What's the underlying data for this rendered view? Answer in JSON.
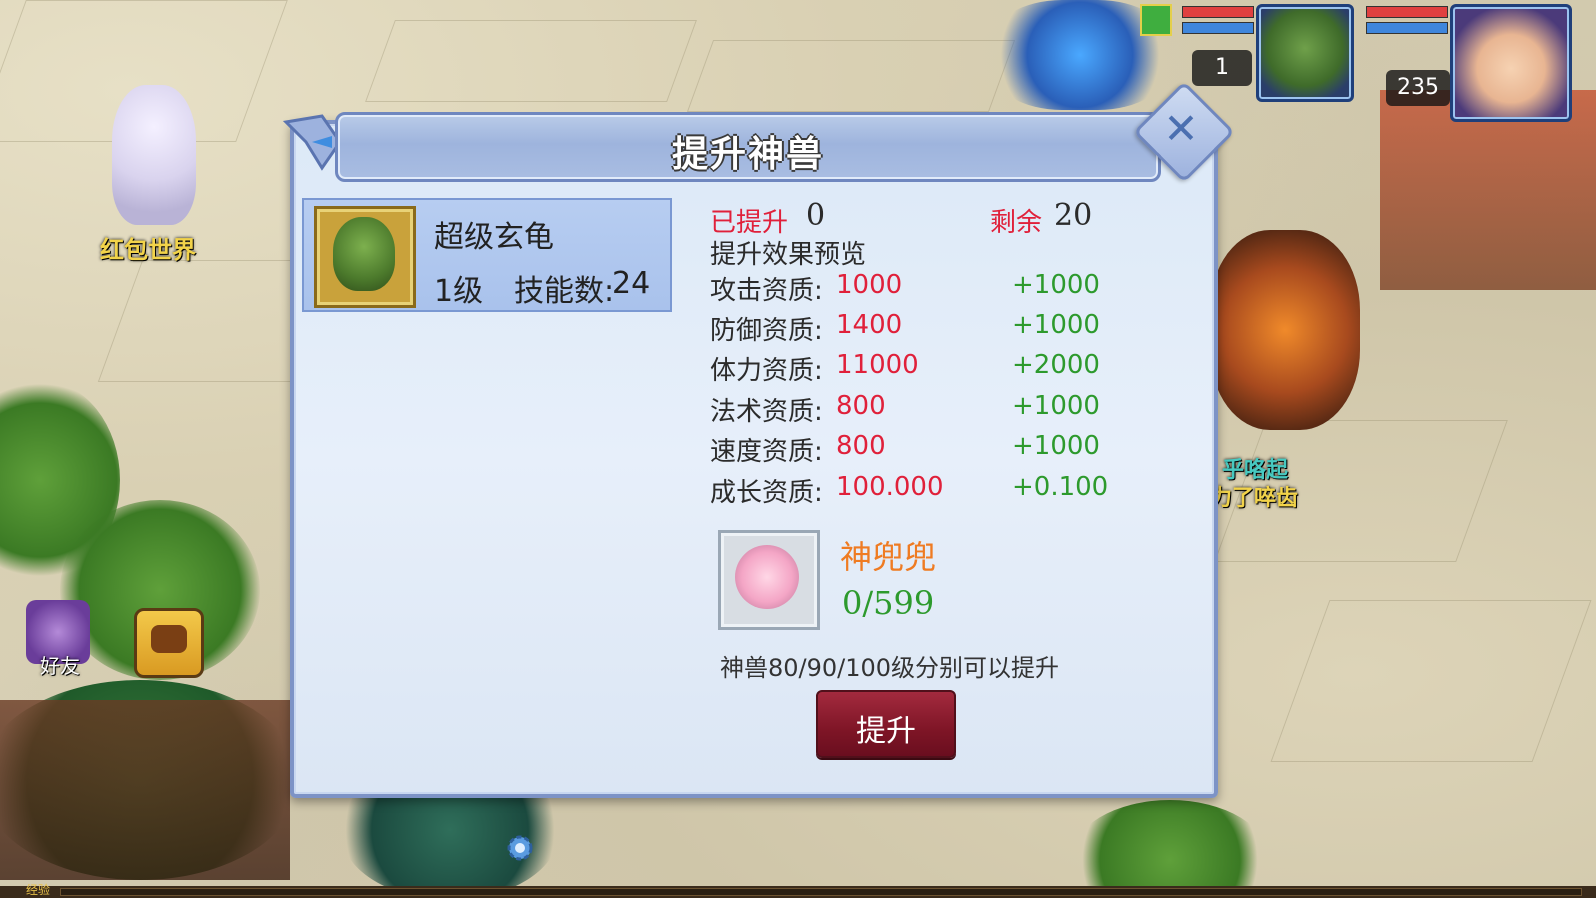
{
  "world": {
    "npc_left_name": "红包世界",
    "npc_right_name_line1": "乎咯起",
    "npc_right_name_line2": "力了啐齿",
    "exp_label": "经验"
  },
  "hud": {
    "pet_level": "1",
    "player_level": "235"
  },
  "side_buttons": {
    "friends_label": "好友"
  },
  "dialog": {
    "title": "提升神兽",
    "pet": {
      "name": "超级玄龟",
      "level": "1级",
      "skill_label": "技能数:",
      "skill_count": "24"
    },
    "upgraded_label": "已提升",
    "upgraded_value": "0",
    "remaining_label": "剩余",
    "remaining_value": "20",
    "preview_label": "提升效果预览",
    "stats": [
      {
        "label": "攻击资质:",
        "value": "1000",
        "bonus": "+1000"
      },
      {
        "label": "防御资质:",
        "value": "1400",
        "bonus": "+1000"
      },
      {
        "label": "体力资质:",
        "value": "11000",
        "bonus": "+2000"
      },
      {
        "label": "法术资质:",
        "value": "800",
        "bonus": "+1000"
      },
      {
        "label": "速度资质:",
        "value": "800",
        "bonus": "+1000"
      },
      {
        "label": "成长资质:",
        "value": "100.000",
        "bonus": "+0.100"
      }
    ],
    "item": {
      "name": "神兜兜",
      "count": "0/599"
    },
    "hint": "神兽80/90/100级分别可以提升",
    "upgrade_button": "提升"
  },
  "colors": {
    "dialog_bg": "#e2ecf8",
    "accent_red": "#e0203a",
    "bonus_green": "#2d9a2d",
    "item_orange": "#ef7b22",
    "button_red": "#7e1526"
  }
}
